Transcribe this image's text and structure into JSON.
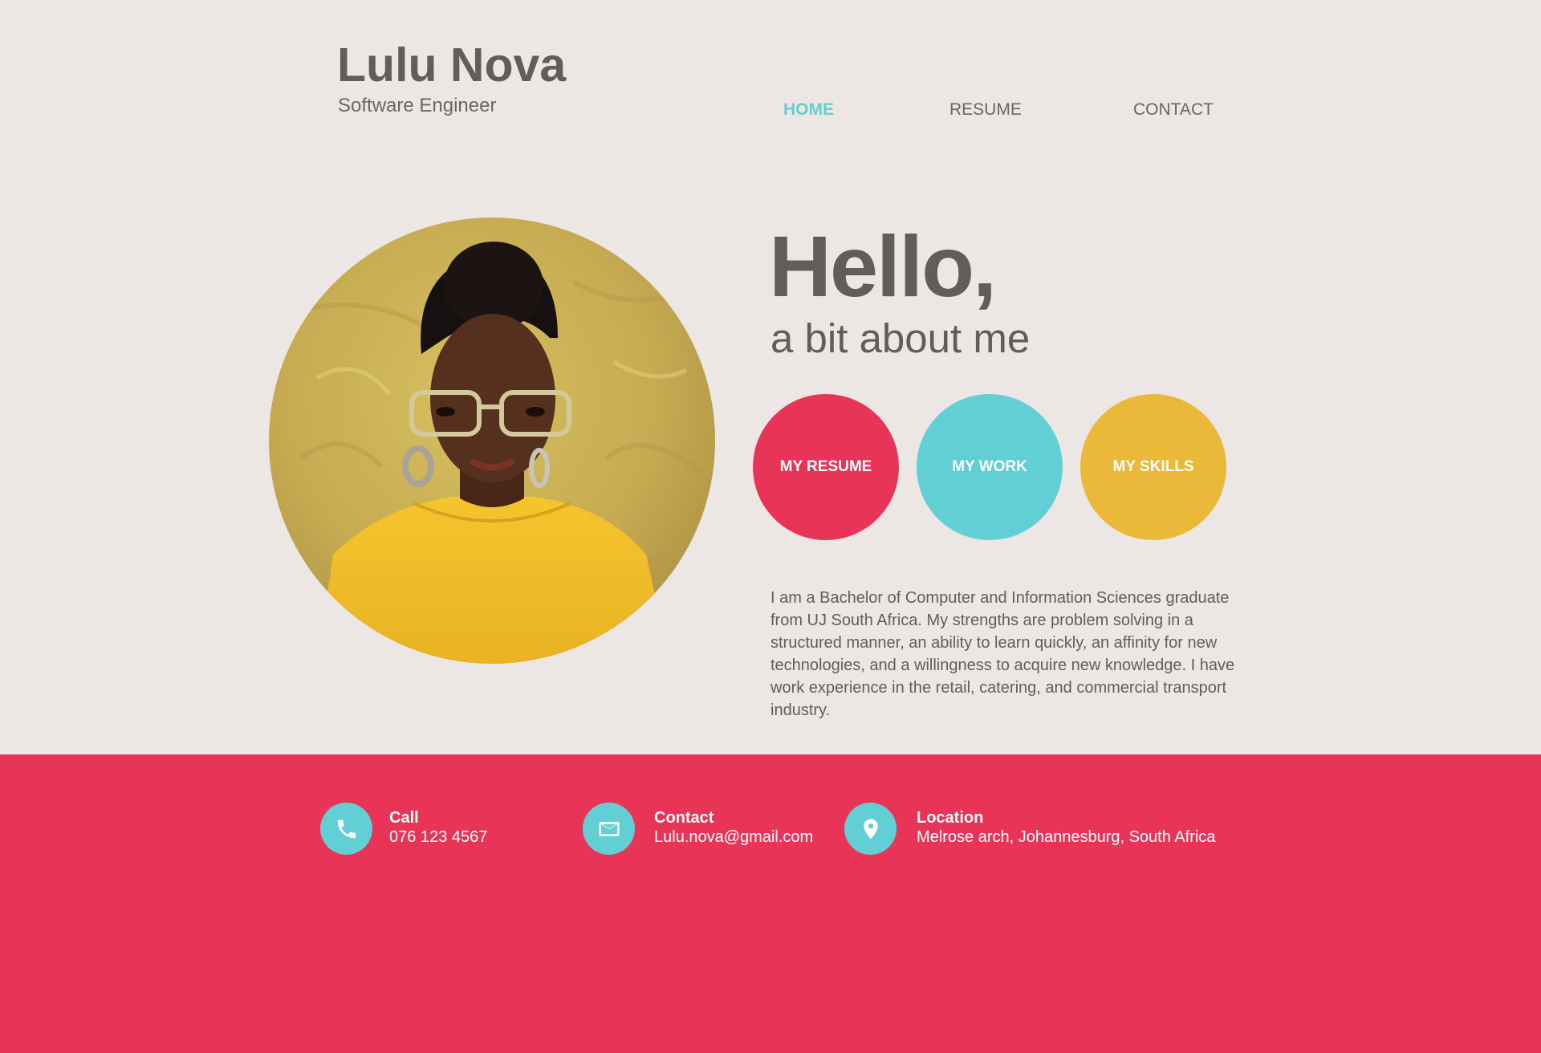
{
  "brand": {
    "name": "Lulu Nova",
    "title": "Software Engineer"
  },
  "nav": {
    "items": [
      {
        "label": "HOME",
        "active": true
      },
      {
        "label": "RESUME",
        "active": false
      },
      {
        "label": "CONTACT",
        "active": false
      }
    ]
  },
  "hero": {
    "heading": "Hello,",
    "subheading": "a bit about me",
    "buttons": [
      {
        "label": "MY RESUME",
        "color": "#e83456"
      },
      {
        "label": "MY WORK",
        "color": "#62cfd5"
      },
      {
        "label": "MY SKILLS",
        "color": "#ebb939"
      }
    ],
    "bio": "I am a Bachelor of Computer and Information Sciences graduate from UJ South Africa. My strengths are problem solving in a structured manner, an ability to learn quickly, an affinity for new technologies, and a willingness to acquire new knowledge. I have work experience in the retail, catering, and commercial transport industry."
  },
  "footer": {
    "contacts": [
      {
        "icon": "phone-icon",
        "heading": "Call",
        "value": "076 123 4567"
      },
      {
        "icon": "mail-icon",
        "heading": "Contact",
        "value": "Lulu.nova@gmail.com"
      },
      {
        "icon": "location-pin-icon",
        "heading": "Location",
        "value": "Melrose arch, Johannesburg, South Africa"
      }
    ]
  },
  "colors": {
    "background": "#ece6e5",
    "accent_teal": "#62cfd5",
    "accent_red": "#e83456",
    "accent_yellow": "#ebb939",
    "text": "#615e58"
  }
}
